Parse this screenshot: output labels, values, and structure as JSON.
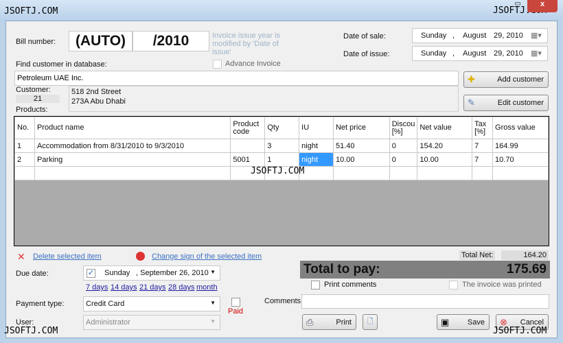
{
  "watermark": "JSOFTJ.COM",
  "bill": {
    "label": "Bill number:",
    "number": "(AUTO)",
    "year": "/2010",
    "note": "Invoice issue year is modified by 'Date of issue'",
    "advance_label": "Advance Invoice"
  },
  "dates": {
    "sale_label": "Date of sale:",
    "issue_label": "Date of issue:",
    "sale": {
      "day": "Sunday",
      "sep": ",",
      "month": "August",
      "date": "29, 2010"
    },
    "issue": {
      "day": "Sunday",
      "sep": ",",
      "month": "August",
      "date": "29, 2010"
    }
  },
  "customer": {
    "find_label": "Find customer in database:",
    "search_value": "Petroleum UAE Inc.",
    "label": "Customer:",
    "id": "21",
    "address1": "518 2nd Street",
    "address2": "273A Abu Dhabi",
    "add_button": "Add customer",
    "edit_button": "Edit customer"
  },
  "products_label": "Products:",
  "table": {
    "headers": [
      "No.",
      "Product name",
      "Product code",
      "Qty",
      "IU",
      "Net price",
      "Discou [%]",
      "Net value",
      "Tax [%]",
      "Gross value"
    ],
    "rows": [
      [
        "1",
        "Accommodation from 8/31/2010 to 9/3/2010",
        "",
        "3",
        "night",
        "51.40",
        "0",
        "154.20",
        "7",
        "164.99"
      ],
      [
        "2",
        "Parking",
        "5001",
        "1",
        "night",
        "10.00",
        "0",
        "10.00",
        "7",
        "10.70"
      ]
    ]
  },
  "actions": {
    "delete": "Delete selected item",
    "change_sign": "Change sign of the selected item"
  },
  "totals": {
    "net_label": "Total Net:",
    "net": "164.20",
    "pay_label": "Total to pay:",
    "pay": "175.69"
  },
  "due": {
    "label": "Due date:",
    "day": "Sunday",
    "date": ", September 26, 2010",
    "checked": true,
    "quick": [
      "7 days",
      "14 days",
      "21 days",
      "28 days",
      "month"
    ]
  },
  "payment": {
    "label": "Payment type:",
    "value": "Credit Card",
    "paid_label": "Paid"
  },
  "user": {
    "label": "User:",
    "value": "Administrator"
  },
  "print_comments": "Print comments",
  "printed_label": "The invoice was printed",
  "comments_label": "Comments:",
  "buttons": {
    "print": "Print",
    "save": "Save",
    "cancel": "Cancel"
  },
  "colors": {
    "total_bg": "#808080",
    "link": "#3a6fc0",
    "paid": "#cc0000",
    "selected": "#3399ff"
  }
}
